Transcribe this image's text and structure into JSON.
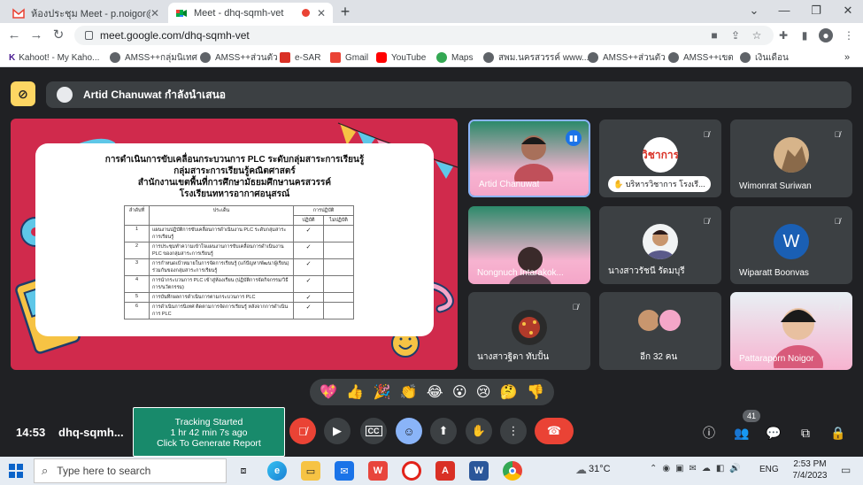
{
  "browser": {
    "tabs": [
      {
        "title": "ห้องประชุม Meet - p.noigor@gmail.c",
        "active": false
      },
      {
        "title": "Meet - dhq-sqmh-vet",
        "active": true
      }
    ],
    "url": "meet.google.com/dhq-sqmh-vet",
    "window_controls": {
      "minimize": "—",
      "restore": "❐",
      "close": "✕",
      "dropdown": "⌄"
    },
    "bookmarks": [
      "Kahoot! - My Kaho...",
      "AMSS++กลุ่มนิเทศ",
      "AMSS++ส่วนตัว",
      "e-SAR",
      "Gmail",
      "YouTube",
      "Maps",
      "สพม.นครสวรรค์ www....",
      "AMSS++ส่วนตัว",
      "AMSS++เขต",
      "เงินเดือน"
    ]
  },
  "meet": {
    "presenter_banner": "Artid Chanuwat กำลังนำเสนอ",
    "slide": {
      "title_lines": [
        "การดำเนินการขับเคลื่อนกระบวนการ PLC ระดับกลุ่มสาระการเรียนรู้",
        "กลุ่มสาระการเรียนรู้คณิตศาสตร์",
        "สำนักงานเขตพื้นที่การศึกษามัธยมศึกษานครสวรรค์",
        "โรงเรียนทหารอากาศอนุสรณ์"
      ],
      "table": {
        "headers": [
          "ลำดับที่",
          "ประเด็น",
          "การปฏิบัติ"
        ],
        "subheaders": [
          "ปฏิบัติ",
          "ไม่ปฏิบัติ"
        ],
        "rows": [
          {
            "no": "1",
            "text": "แผนงานปฏิบัติการขับเคลื่อนการดำเนินงาน PLC ระดับกลุ่มสาระการเรียนรู้",
            "done": "✓"
          },
          {
            "no": "2",
            "text": "การประชุมทำความเข้าใจแผนงานการขับเคลื่อนการดำเนินงาน PLC ของกลุ่มสาระการเรียนรู้",
            "done": "✓"
          },
          {
            "no": "3",
            "text": "การกำหนดเป้าหมายในการจัดการเรียนรู้ (แก้ปัญหา/พัฒนาผู้เรียน) ร่วมกันของกลุ่มสาระการเรียนรู้",
            "done": "✓"
          },
          {
            "no": "4",
            "text": "การนำกระบวนการ PLC เข้าสู่ห้องเรียน (ปฏิบัติการจัดกิจกรรม/วิธีการ/นวัตกรรม)",
            "done": "✓"
          },
          {
            "no": "5",
            "text": "การบันทึกผลการดำเนินการตามกระบวนการ PLC",
            "done": "✓"
          },
          {
            "no": "6",
            "text": "การดำเนินการนิเทศ ติดตามการจัดการเรียนรู้ หลังจากการดำเนินการ PLC",
            "done": "✓"
          }
        ]
      }
    },
    "participants": [
      {
        "name": "Artid Chanuwat",
        "kind": "video",
        "speaking": true
      },
      {
        "name": "บริหารวิชาการ โรงเรี...",
        "kind": "logo",
        "logo_text": "วิชาการ"
      },
      {
        "name": "Wimonrat Suriwan",
        "kind": "photo"
      },
      {
        "name": "Nongnuch Intarakok...",
        "kind": "video"
      },
      {
        "name": "นางสาวรัชนี รัดมบุรี",
        "kind": "photo"
      },
      {
        "name": "Wiparatt Boonvas",
        "kind": "letter",
        "letter": "W"
      },
      {
        "name": "นางสาวฐิดา ทับปั้น",
        "kind": "photo"
      },
      {
        "name": "อีก 32 คน",
        "kind": "more"
      },
      {
        "name": "Pattaraporn Noigor",
        "kind": "video"
      }
    ],
    "reactions": [
      "💖",
      "👍",
      "🎉",
      "👏",
      "😂",
      "😮",
      "😢",
      "🤔",
      "👎"
    ],
    "clock": "14:53",
    "meeting_code": "dhq-sqmh...",
    "tracking": {
      "line1": "Tracking Started",
      "line2": "1 hr 42 min 7s ago",
      "line3": "Click To Generate Report"
    },
    "people_count": "41"
  },
  "taskbar": {
    "search_placeholder": "Type here to search",
    "weather": "31°C",
    "language": "ENG",
    "time": "2:53 PM",
    "date": "7/4/2023"
  }
}
